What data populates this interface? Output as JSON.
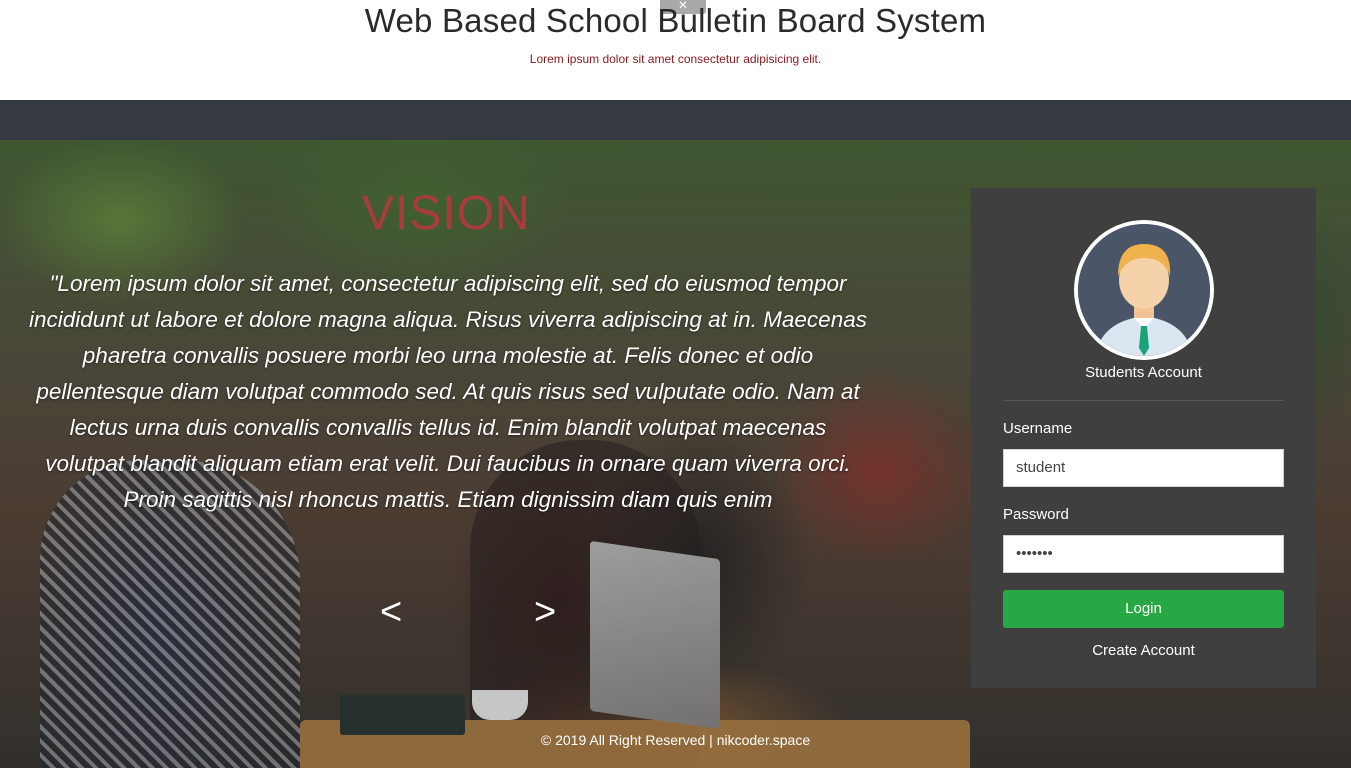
{
  "header": {
    "title": "Web Based School Bulletin Board System",
    "subtitle": "Lorem ipsum dolor sit amet consectetur adipisicing elit.",
    "close_glyph": "×"
  },
  "hero": {
    "heading": "VISION",
    "quote": "\"Lorem ipsum dolor sit amet, consectetur adipiscing elit, sed do eiusmod tempor incididunt ut labore et dolore magna aliqua. Risus viverra adipiscing at in. Maecenas pharetra convallis posuere morbi leo urna molestie at. Felis donec et odio pellentesque diam volutpat commodo sed. At quis risus sed vulputate odio. Nam at lectus urna duis convallis convallis tellus id. Enim blandit volutpat maecenas volutpat blandit aliquam etiam erat velit. Dui faucibus in ornare quam viverra orci. Proin sagittis nisl rhoncus mattis. Etiam dignissim diam quis enim",
    "prev_label": "<",
    "next_label": ">"
  },
  "login": {
    "account_label": "Students Account",
    "username_label": "Username",
    "username_value": "student",
    "password_label": "Password",
    "password_value": "•••••••",
    "login_button": "Login",
    "create_account": "Create Account"
  },
  "footer": {
    "text": "© 2019 All Right Reserved | nikcoder.space"
  },
  "colors": {
    "navbar": "#343a40",
    "vision_heading": "#a83c3c",
    "login_panel": "#3f3f3f",
    "login_button": "#28a745",
    "subtitle": "#8b1a1a"
  },
  "icons": [
    "close-icon",
    "user-avatar-icon"
  ]
}
